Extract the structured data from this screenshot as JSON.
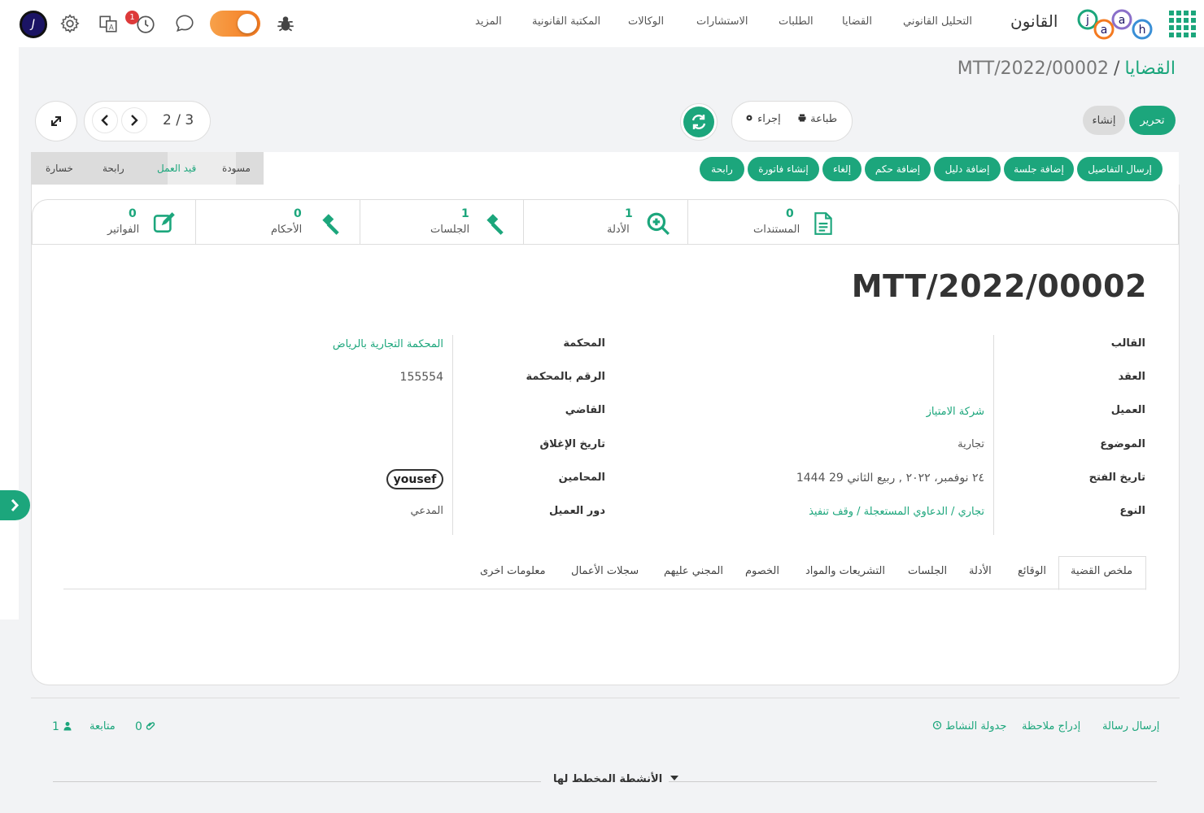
{
  "topnav": {
    "brand": "القانون",
    "items": [
      "التحليل القانوني",
      "القضايا",
      "الطلبات",
      "الاستشارات",
      "الوكالات",
      "المكتبة القانونية",
      "المزيد"
    ],
    "avatar_letter": "J",
    "notif_count": "1"
  },
  "breadcrumb": {
    "root": "القضايا",
    "sep": "/",
    "current": "MTT/2022/00002"
  },
  "controls": {
    "edit": "تحرير",
    "create": "إنشاء",
    "print": "طباعة",
    "action": "إجراء",
    "pager": "2 / 3"
  },
  "stages": [
    "مسودة",
    "قيد العمل",
    "رابحة",
    "خسارة"
  ],
  "actions": [
    "إرسال التفاصيل",
    "إضافة جلسة",
    "إضافة دليل",
    "إضافة حكم",
    "إلغاء",
    "إنشاء فاتورة",
    "رابحة"
  ],
  "stats": [
    {
      "num": "0",
      "label": "المستندات"
    },
    {
      "num": "1",
      "label": "الأدلة"
    },
    {
      "num": "1",
      "label": "الجلسات"
    },
    {
      "num": "0",
      "label": "الأحكام"
    },
    {
      "num": "0",
      "label": "الفواتير"
    }
  ],
  "record_title": "MTT/2022/00002",
  "fields_right": [
    {
      "label": "القالب",
      "value": ""
    },
    {
      "label": "العقد",
      "value": ""
    },
    {
      "label": "العميل",
      "value": "شركة الامتياز"
    },
    {
      "label": "الموضوع",
      "value": "تجارية"
    },
    {
      "label": "تاريخ الفتح",
      "value": "٢٤ نوفمبر، ٢٠٢٢ , ربيع الثاني 29 1444"
    },
    {
      "label": "النوع",
      "value": "تجاري / الدعاوي المستعجلة / وقف تنفيذ"
    }
  ],
  "fields_left": [
    {
      "label": "المحكمة",
      "value": "المحكمة التجارية بالرياض"
    },
    {
      "label": "الرقم بالمحكمة",
      "value": "155554"
    },
    {
      "label": "القاضي",
      "value": ""
    },
    {
      "label": "تاريخ الإغلاق",
      "value": ""
    },
    {
      "label": "المحامين",
      "value": "yousef"
    },
    {
      "label": "دور العميل",
      "value": "المدعي"
    }
  ],
  "tabs": [
    "ملخص القضية",
    "الوقائع",
    "الأدلة",
    "الجلسات",
    "التشريعات والمواد",
    "الخصوم",
    "المجني عليهم",
    "سجلات الأعمال",
    "معلومات اخرى"
  ],
  "chatter": {
    "send_message": "إرسال رسالة",
    "log_note": "إدراج ملاحظة",
    "schedule": "جدولة النشاط",
    "follow": "متابعة",
    "attachments": "0",
    "followers": "1",
    "planned": "الأنشطة المخطط لها"
  },
  "colors": {
    "accent": "#1ca67c",
    "badge": "#dd3a3a",
    "toggle": "#f47a20"
  }
}
